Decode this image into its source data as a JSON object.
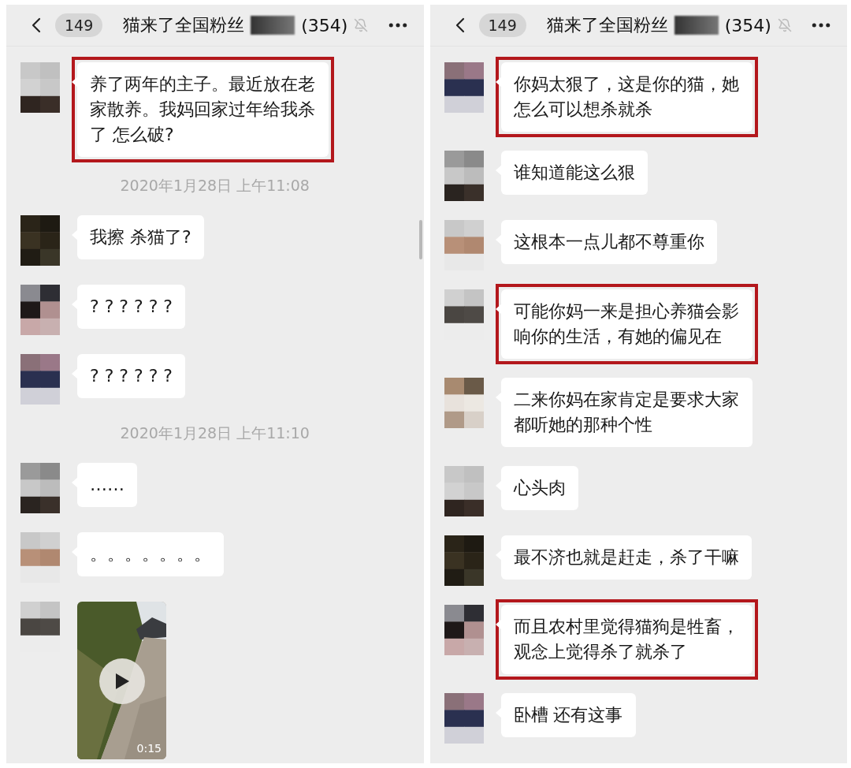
{
  "panels": [
    {
      "header": {
        "back_badge": "149",
        "title": "猫来了全国粉丝",
        "member_count": "(354)",
        "muted": true
      },
      "messages": [
        {
          "kind": "text",
          "text": "养了两年的主子。最近放在老家散养。我妈回家过年给我杀了 怎么破?",
          "highlighted": true
        },
        {
          "kind": "time",
          "text": "2020年1月28日 上午11:08"
        },
        {
          "kind": "text",
          "text": "我擦 杀猫了?",
          "highlighted": false
        },
        {
          "kind": "text",
          "text": "? ? ? ? ? ?",
          "highlighted": false
        },
        {
          "kind": "text",
          "text": "? ? ? ? ? ?",
          "highlighted": false
        },
        {
          "kind": "time",
          "text": "2020年1月28日 上午11:10"
        },
        {
          "kind": "text",
          "text": "……",
          "highlighted": false
        },
        {
          "kind": "text",
          "text": "。。。。。。。",
          "highlighted": false
        },
        {
          "kind": "video",
          "duration": "0:15"
        }
      ]
    },
    {
      "header": {
        "back_badge": "149",
        "title": "猫来了全国粉丝",
        "member_count": "(354)",
        "muted": true
      },
      "messages": [
        {
          "kind": "text",
          "text": "你妈太狠了，这是你的猫，她怎么可以想杀就杀",
          "highlighted": true
        },
        {
          "kind": "text",
          "text": "谁知道能这么狠",
          "highlighted": false
        },
        {
          "kind": "text",
          "text": "这根本一点儿都不尊重你",
          "highlighted": false
        },
        {
          "kind": "text",
          "text": "可能你妈一来是担心养猫会影响你的生活，有她的偏见在",
          "highlighted": true
        },
        {
          "kind": "text",
          "text": "二来你妈在家肯定是要求大家都听她的那种个性",
          "highlighted": false
        },
        {
          "kind": "text",
          "text": "心头肉",
          "highlighted": false
        },
        {
          "kind": "text",
          "text": "最不济也就是赶走，杀了干嘛",
          "highlighted": false
        },
        {
          "kind": "text",
          "text": "而且农村里觉得猫狗是牲畜，观念上觉得杀了就杀了",
          "highlighted": true
        },
        {
          "kind": "text",
          "text": "卧槽 还有这事",
          "highlighted": false
        }
      ]
    }
  ]
}
